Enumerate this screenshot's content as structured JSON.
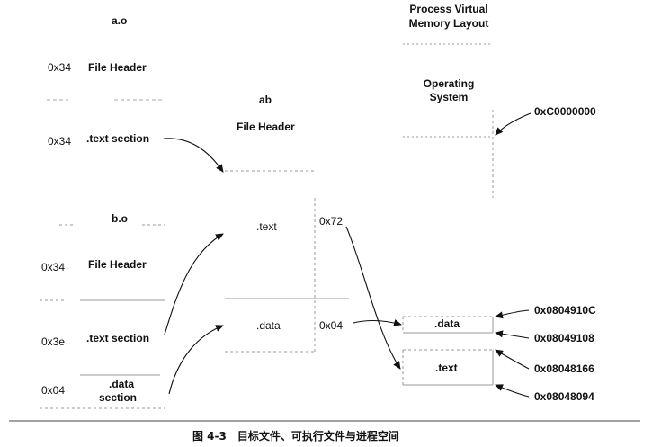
{
  "ao": {
    "title": "a.o",
    "header_off": "0x34",
    "header_label": "File Header",
    "text_off": "0x34",
    "text_label": ".text section"
  },
  "bo": {
    "title": "b.o",
    "header_off": "0x34",
    "header_label": "File Header",
    "text_off": "0x3e",
    "text_label": ".text section",
    "data_off": "0x04",
    "data_label_1": ".data",
    "data_label_2": "section"
  },
  "ab": {
    "title": "ab",
    "header_label": "File Header",
    "text_label": ".text",
    "data_label": ".data",
    "text_size": "0x72",
    "data_size": "0x04"
  },
  "vm": {
    "title_1": "Process Virtual",
    "title_2": "Memory Layout",
    "os_1": "Operating",
    "os_2": "System",
    "data_label": ".data",
    "text_label": ".text",
    "addr_top": "0xC0000000",
    "addr_1": "0x0804910C",
    "addr_2": "0x08049108",
    "addr_3": "0x08048166",
    "addr_4": "0x08048094"
  },
  "caption": "图 4-3　目标文件、可执行文件与进程空间"
}
